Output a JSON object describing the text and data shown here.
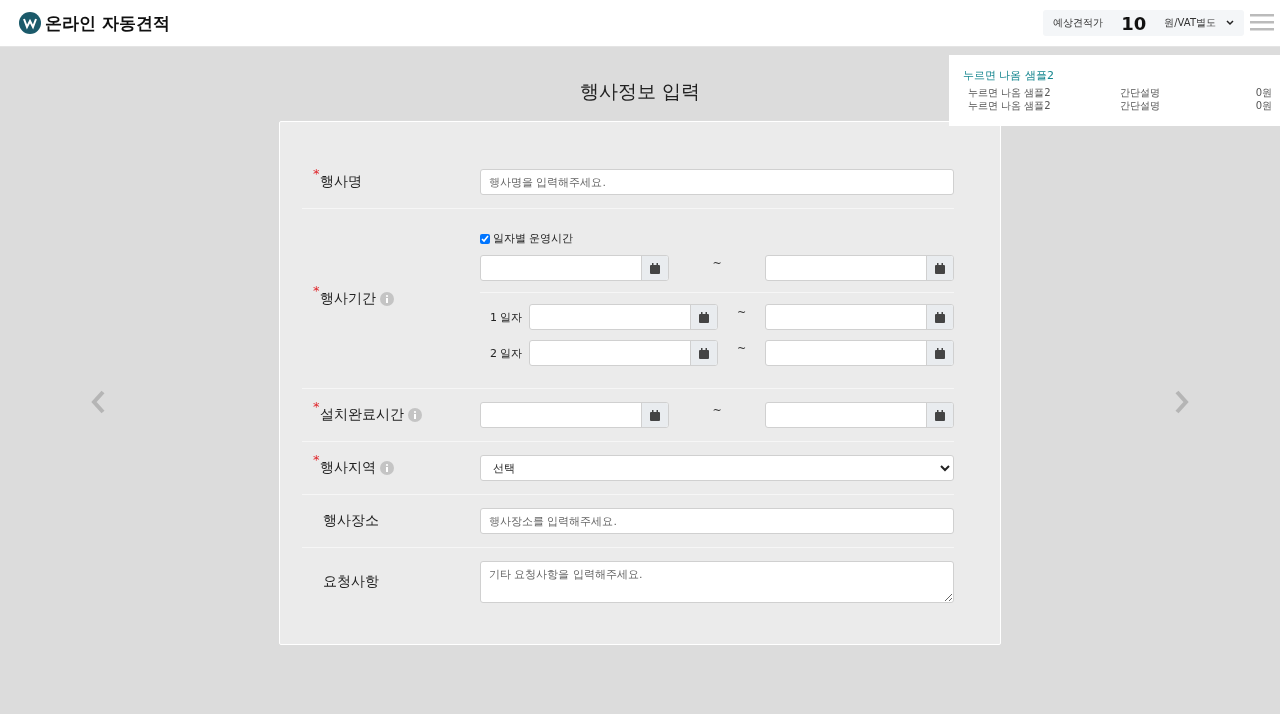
{
  "header": {
    "logo_text": "온라인 자동견적",
    "estimate": {
      "label": "예상견적가",
      "amount": "10",
      "unit": "원/VAT별도"
    }
  },
  "summary_panel": {
    "title": "누르면 나옴 샘플2",
    "rows": [
      {
        "name": "누르면 나옴 샘플2",
        "description": "간단설명",
        "price": "0원"
      },
      {
        "name": "누르면 나옴 샘플2",
        "description": "간단설명",
        "price": "0원"
      }
    ]
  },
  "page_title": "행사정보 입력",
  "form": {
    "required_mark": "*",
    "fields": [
      {
        "kind": "text",
        "label": "행사명",
        "required": true,
        "info": false,
        "placeholder": "행사명을 입력해주세요."
      },
      {
        "kind": "period",
        "label": "행사기간",
        "required": true,
        "info": true,
        "checkbox": {
          "label": "일자별 운영시간",
          "checked": true
        },
        "separator": "~",
        "days": [
          {
            "label": "1 일자",
            "separator": "~"
          },
          {
            "label": "2 일자",
            "separator": "~"
          }
        ]
      },
      {
        "kind": "range",
        "label": "설치완료시간",
        "required": true,
        "info": true,
        "separator": "~"
      },
      {
        "kind": "select",
        "label": "행사지역",
        "required": true,
        "info": true,
        "value": "선택"
      },
      {
        "kind": "text",
        "label": "행사장소",
        "required": false,
        "info": false,
        "placeholder": "행사장소를 입력해주세요."
      },
      {
        "kind": "textarea",
        "label": "요청사항",
        "required": false,
        "info": false,
        "placeholder": "기타 요청사항을 입력해주세요."
      }
    ]
  }
}
